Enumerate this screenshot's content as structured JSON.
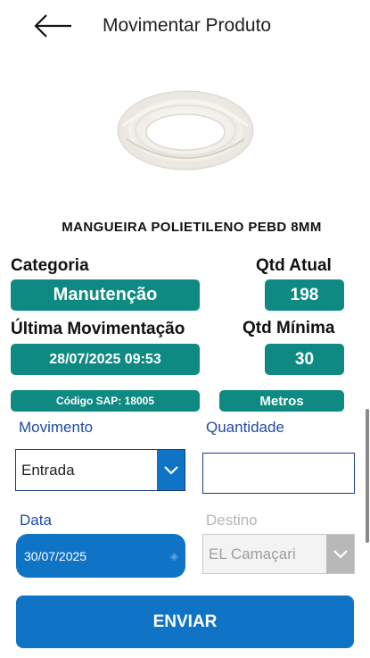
{
  "header": {
    "title": "Movimentar Produto",
    "back_icon": "arrow-left-icon"
  },
  "product": {
    "image_icon": "coiled-hose-image",
    "name": "MANGUEIRA POLIETILENO PEBD 8MM"
  },
  "info": {
    "category_label": "Categoria",
    "category_value": "Manutenção",
    "qty_current_label": "Qtd Atual",
    "qty_current_value": "198",
    "last_movement_label": "Última Movimentação",
    "last_movement_value": "28/07/2025 09:53",
    "qty_min_label": "Qtd Mínima",
    "qty_min_value": "30",
    "sap_code": "Código SAP: 18005",
    "unit": "Metros"
  },
  "form": {
    "movement_label": "Movimento",
    "movement_value": "Entrada",
    "quantity_label": "Quantidade",
    "quantity_value": "",
    "date_label": "Data",
    "date_value": "30/07/2025",
    "destination_label": "Destino",
    "destination_value": "EL Camaçari",
    "submit_label": "ENVIAR"
  },
  "colors": {
    "teal": "#0f8a82",
    "blue": "#0f73c6",
    "label_blue": "#1f4aa8",
    "disabled_gray": "#b5b5b5"
  }
}
